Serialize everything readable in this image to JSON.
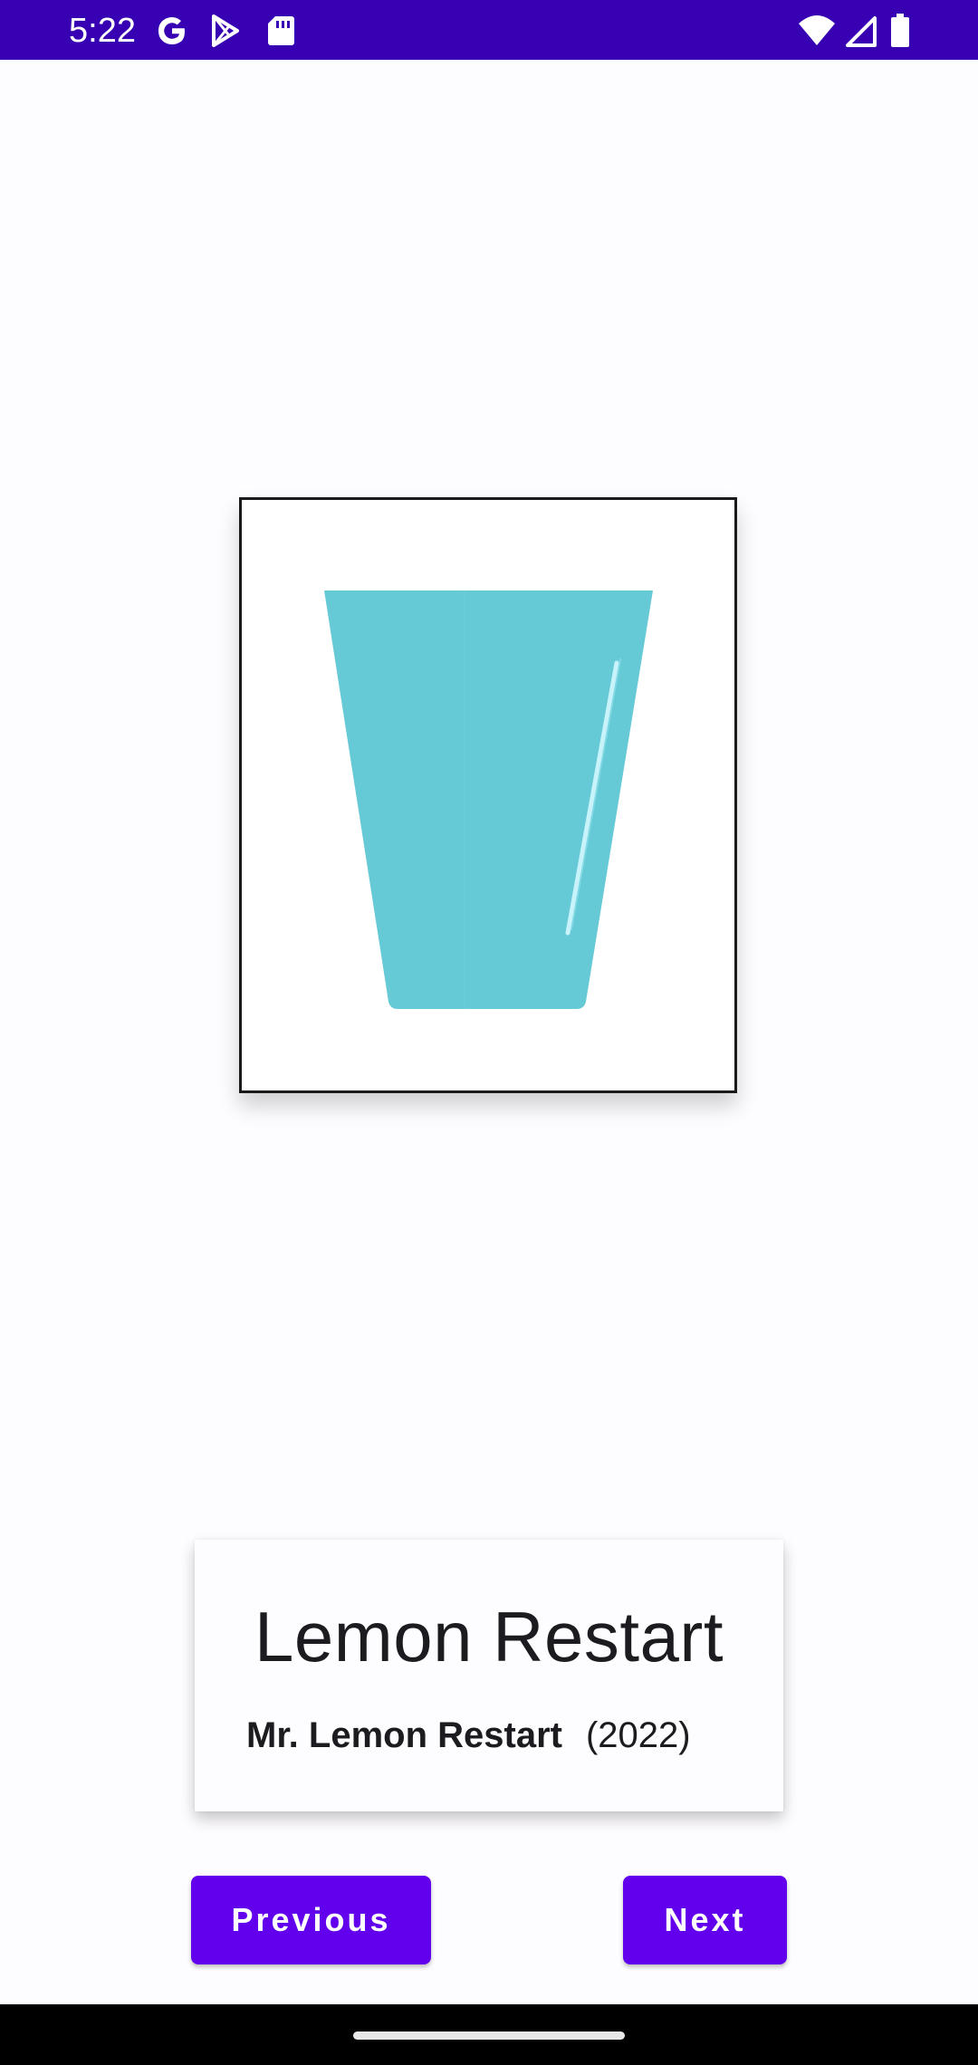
{
  "status_bar": {
    "time": "5:22",
    "icons_left": [
      "google-icon",
      "play-store-icon",
      "sd-card-icon"
    ],
    "icons_right": [
      "wifi-icon",
      "cellular-signal-icon",
      "battery-icon"
    ],
    "background": "#3700b3"
  },
  "artwork": {
    "image_icon": "lemon-glass-icon",
    "glass_color": "#66c9d6",
    "title": "Lemon Restart",
    "artist": "Mr. Lemon Restart",
    "year": "(2022)"
  },
  "controls": {
    "previous_label": "Previous",
    "next_label": "Next",
    "accent": "#6200ee"
  },
  "nav_bar": {
    "handle": "gesture-handle"
  }
}
